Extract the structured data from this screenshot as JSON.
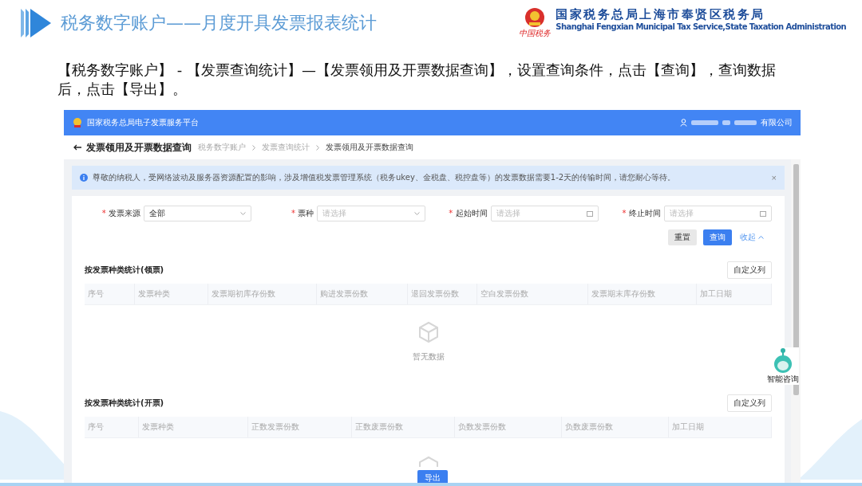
{
  "slide": {
    "title": "税务数字账户——月度开具发票报表统计",
    "org_name": "国家税务总局上海市奉贤区税务局",
    "org_name_en": "Shanghai Fengxian Municipal Tax Service,State Taxation Administration",
    "motto": "中国税务",
    "instruction": "【税务数字账户】 - 【发票查询统计】—【发票领用及开票数据查询】，设置查询条件，点击【查询】，查询数据后，点击【导出】。"
  },
  "app": {
    "platform_name": "国家税务总局电子发票服务平台",
    "user_company": "有限公司",
    "page_title": "发票领用及开票数据查询",
    "breadcrumb": [
      {
        "label": "税务数字账户",
        "current": false
      },
      {
        "label": "发票查询统计",
        "current": false
      },
      {
        "label": "发票领用及开票数据查询",
        "current": true
      }
    ],
    "notice": "尊敬的纳税人，受网络波动及服务器资源配置的影响，涉及增值税发票管理系统（税务ukey、金税盘、税控盘等）的发票数据需要1-2天的传输时间，请您耐心等待。",
    "notice_close": "×",
    "filters": [
      {
        "mark": "*",
        "label": "发票来源",
        "kind": "select",
        "value": "全部"
      },
      {
        "mark": "*",
        "label": "票种",
        "kind": "select",
        "placeholder": "请选择"
      },
      {
        "mark": "*",
        "label": "起始时间",
        "kind": "date",
        "placeholder": "请选择"
      },
      {
        "mark": "*",
        "label": "终止时间",
        "kind": "date",
        "placeholder": "请选择"
      }
    ],
    "actions": [
      {
        "label": "重置",
        "kind": "default"
      },
      {
        "label": "查询",
        "kind": "primary"
      },
      {
        "label": "收起",
        "kind": "link"
      }
    ],
    "sections": [
      {
        "title": "按发票种类统计(领票)",
        "custom_button": "自定义列",
        "columns": [
          "序号",
          "发票种类",
          "发票期初库存份数",
          "购进发票份数",
          "退回发票份数",
          "空白发票份数",
          "发票期末库存份数",
          "加工日期"
        ],
        "empty_text": "暂无数据"
      },
      {
        "title": "按发票种类统计(开票)",
        "custom_button": "自定义列",
        "columns": [
          "序号",
          "发票种类",
          "正数发票份数",
          "正数废票份数",
          "负数发票份数",
          "负数废票份数",
          "加工日期"
        ]
      }
    ],
    "export_button": "导出",
    "assistant_label": "智能咨询"
  }
}
